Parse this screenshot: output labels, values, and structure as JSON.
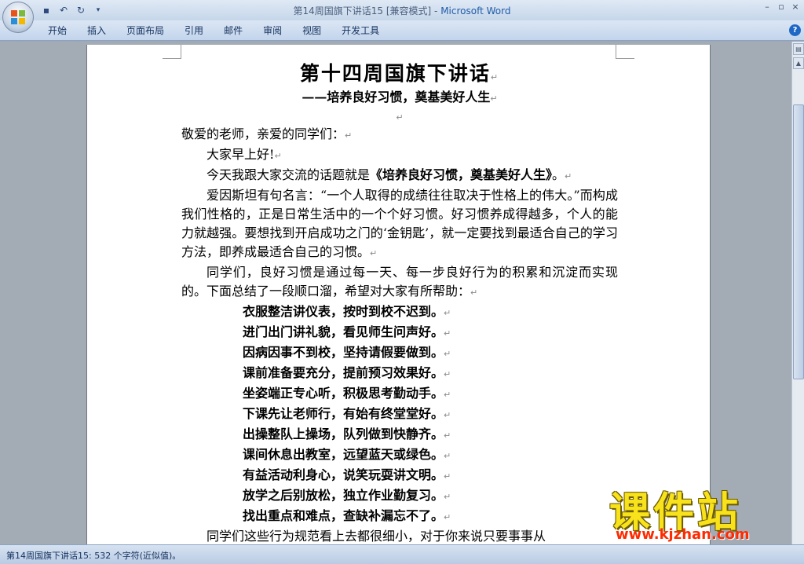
{
  "window": {
    "title": "第14周国旗下讲话15 [兼容模式]",
    "title_sep": " - ",
    "app_name": "Microsoft Word"
  },
  "quick_access": {
    "save_icon": "save-icon",
    "undo_icon": "undo-icon",
    "redo_icon": "redo-icon"
  },
  "ribbon": {
    "tabs": [
      "开始",
      "插入",
      "页面布局",
      "引用",
      "邮件",
      "审阅",
      "视图",
      "开发工具"
    ],
    "help": "?"
  },
  "document": {
    "title": "第十四周国旗下讲话",
    "subtitle": "——培养良好习惯，奠基美好人生",
    "greeting": "敬爱的老师，亲爱的同学们：",
    "hello": "大家早上好!",
    "topic_prefix": "今天我跟大家交流的话题就是",
    "topic_title": "《培养良好习惯，奠基美好人生》",
    "topic_suffix": "。",
    "para_quote": "爱因斯坦有句名言：“一个人取得的成绩往往取决于性格上的伟大。”而构成我们性格的，正是日常生活中的一个个好习惯。好习惯养成得越多，个人的能力就越强。要想找到开启成功之门的‘金钥匙’，就一定要找到最适合自己的学习方法，即养成最适合自己的习惯。",
    "para_intro": "同学们，良好习惯是通过每一天、每一步良好行为的积累和沉淀而实现的。下面总结了一段顺口溜，希望对大家有所帮助：",
    "verses": [
      "衣服整洁讲仪表，按时到校不迟到。",
      "进门出门讲礼貌，看见师生问声好。",
      "因病因事不到校，坚持请假要做到。",
      "课前准备要充分，提前预习效果好。",
      "坐姿端正专心听，积极思考勤动手。",
      "下课先让老师行，有始有终堂堂好。",
      "出操整队上操场，队列做到快静齐。",
      "课间休息出教室，远望蓝天或绿色。",
      "有益活动利身心，说笑玩耍讲文明。",
      "放学之后别放松，独立作业勤复习。",
      "找出重点和难点，查缺补漏忘不了。"
    ],
    "para_last": "同学们这些行为规范看上去都很细小，对于你来说只要事事从",
    "para_mark": "↵"
  },
  "status_bar": {
    "text": "第14周国旗下讲话15: 532 个字符(近似值)。"
  },
  "watermark": {
    "brand": "课件站",
    "url": "www.kjzhan.com"
  },
  "colors": {
    "app_name": "#1e5ca8",
    "watermark_brand": "#f7e21b",
    "watermark_url": "#ff2a00"
  }
}
